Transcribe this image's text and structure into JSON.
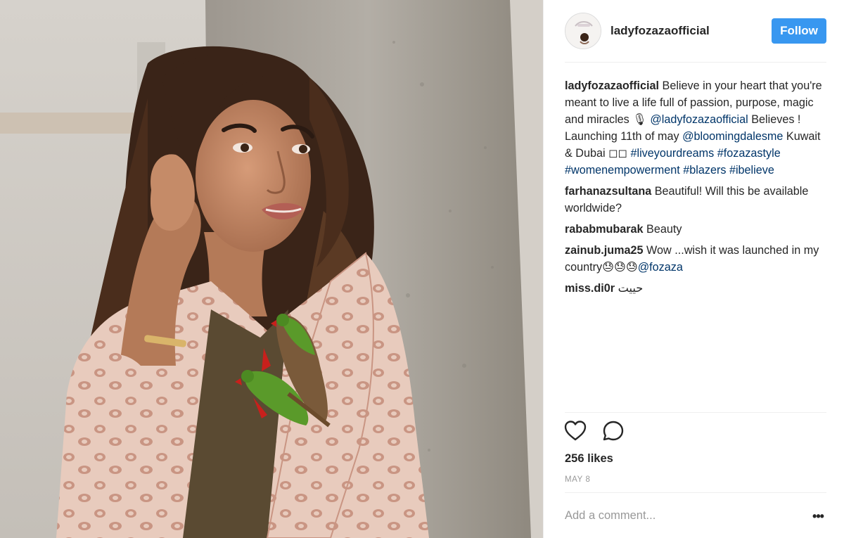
{
  "photo": {
    "alt": "",
    "colors": {
      "pillar": "#a8a29a",
      "blazer": "#e5c4b5",
      "hair": "#3a2418",
      "skin": "#c58b68",
      "parrot_green": "#5a9a2a",
      "parrot_red": "#c8201c"
    }
  },
  "header": {
    "username": "ladyfozazaofficial",
    "follow_label": "Follow"
  },
  "comments": [
    {
      "user": "ladyfozazaofficial",
      "parts": [
        {
          "t": "text",
          "v": " Believe in your heart that you're meant to live a life full of passion, purpose, magic and miracles 🎙\n"
        },
        {
          "t": "link",
          "v": "@ladyfozazaofficial"
        },
        {
          "t": "text",
          "v": " Believes ! Launching 11th of may "
        },
        {
          "t": "link",
          "v": "@bloomingdalesme"
        },
        {
          "t": "text",
          "v": " Kuwait & Dubai ◻◻ "
        },
        {
          "t": "link",
          "v": "#liveyourdreams"
        },
        {
          "t": "text",
          "v": " "
        },
        {
          "t": "link",
          "v": "#fozazastyle"
        },
        {
          "t": "text",
          "v": " "
        },
        {
          "t": "link",
          "v": "#womenempowerment"
        },
        {
          "t": "text",
          "v": " "
        },
        {
          "t": "link",
          "v": "#blazers"
        },
        {
          "t": "text",
          "v": " "
        },
        {
          "t": "link",
          "v": "#ibelieve"
        }
      ]
    },
    {
      "user": "farhanazsultana",
      "parts": [
        {
          "t": "text",
          "v": " Beautiful! Will this be available worldwide?"
        }
      ]
    },
    {
      "user": "rababmubarak",
      "parts": [
        {
          "t": "text",
          "v": " Beauty"
        }
      ]
    },
    {
      "user": "zainub.juma25",
      "parts": [
        {
          "t": "text",
          "v": " Wow ...wish it was launched in my country😓😓😓"
        },
        {
          "t": "link",
          "v": "@fozaza"
        }
      ]
    },
    {
      "user": "miss.di0r",
      "parts": [
        {
          "t": "text",
          "v": " حييت"
        }
      ]
    }
  ],
  "actions": {
    "like_icon": "heart-icon",
    "comment_icon": "comment-bubble-icon"
  },
  "likes": "256 likes",
  "date": "MAY 8",
  "comment_box": {
    "placeholder": "Add a comment..."
  },
  "more_icon": "more-options-icon"
}
